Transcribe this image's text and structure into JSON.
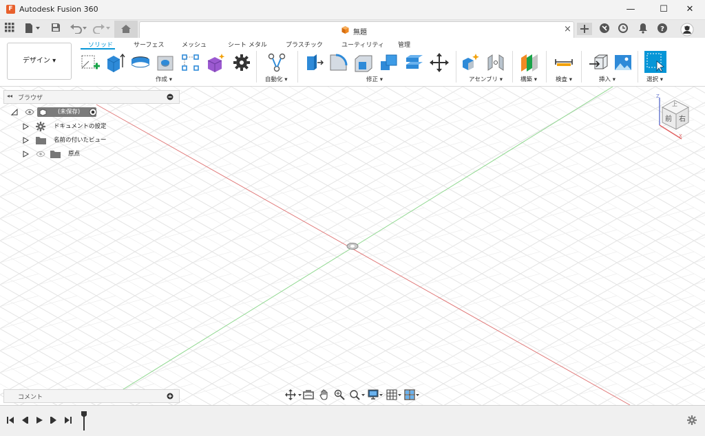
{
  "window": {
    "title": "Autodesk Fusion 360",
    "minimize": "—",
    "maximize": "☐",
    "close": "✕",
    "app_icon_letter": "F"
  },
  "document": {
    "tab_title": "無題",
    "close_glyph": "×"
  },
  "workspace": {
    "label": "デザイン ▾"
  },
  "ribbon_tabs": [
    {
      "label": "ソリッド"
    },
    {
      "label": "サーフェス"
    },
    {
      "label": "メッシュ"
    },
    {
      "label": "シート メタル"
    },
    {
      "label": "プラスチック"
    },
    {
      "label": "ユーティリティ"
    },
    {
      "label": "管理"
    }
  ],
  "groups": {
    "create": "作成 ▾",
    "automate": "自動化 ▾",
    "modify": "修正 ▾",
    "assemble": "アセンブリ ▾",
    "construct": "構築 ▾",
    "inspect": "検査 ▾",
    "insert": "挿入 ▾",
    "select": "選択 ▾"
  },
  "browser": {
    "title": "ブラウザ",
    "root": "(未保存)",
    "items": [
      {
        "label": "ドキュメントの設定"
      },
      {
        "label": "名前の付いたビュー"
      },
      {
        "label": "原点"
      }
    ]
  },
  "comments": {
    "title": "コメント"
  },
  "viewcube": {
    "top": "上",
    "front": "前",
    "right": "右",
    "axis_z": "Z",
    "axis_x": "X"
  },
  "colors": {
    "accent": "#0696d7",
    "x_axis": "#e07a7a",
    "y_axis": "#8fd88f",
    "grid": "#e4e4e4",
    "ribbon_blue": "#2e8ad8",
    "orange": "#f08a24"
  }
}
